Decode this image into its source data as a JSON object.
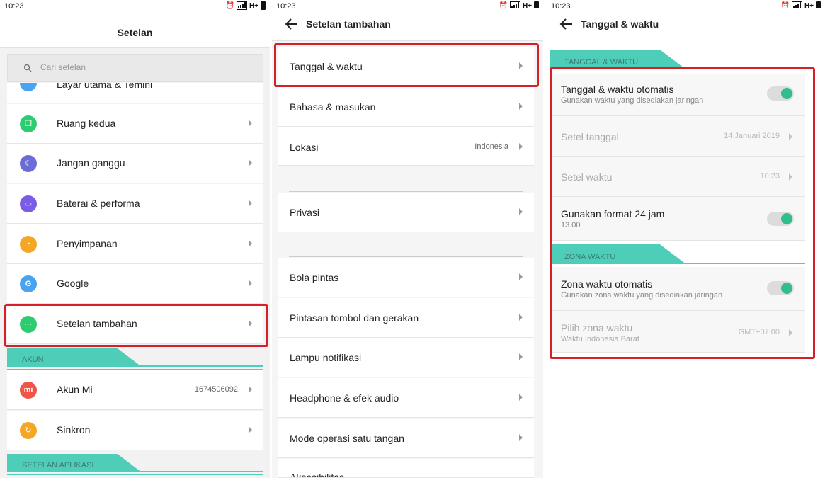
{
  "status_bar": {
    "time": "10:23",
    "network": "H+"
  },
  "screen1": {
    "title": "Setelan",
    "search_placeholder": "Cari setelan",
    "partial_item": "Layar utama & Temini",
    "items": [
      {
        "label": "Ruang kedua",
        "icon": "copy-icon",
        "color": "#2ecc71"
      },
      {
        "label": "Jangan ganggu",
        "icon": "moon-icon",
        "color": "#6c6cd8"
      },
      {
        "label": "Baterai & performa",
        "icon": "battery-icon",
        "color": "#7b5ce6"
      },
      {
        "label": "Penyimpanan",
        "icon": "storage-icon",
        "color": "#f5a623"
      },
      {
        "label": "Google",
        "icon": "google-icon",
        "color": "#4aa3f0"
      },
      {
        "label": "Setelan tambahan",
        "icon": "more-icon",
        "color": "#2ecc71"
      }
    ],
    "section_akun": "AKUN",
    "akun_items": [
      {
        "label": "Akun Mi",
        "value": "1674506092",
        "icon": "mi-icon",
        "color": "#f05545"
      },
      {
        "label": "Sinkron",
        "icon": "sync-icon",
        "color": "#f5a623"
      }
    ],
    "section_apps": "SETELAN APLIKASI"
  },
  "screen2": {
    "title": "Setelan tambahan",
    "group1": [
      {
        "label": "Tanggal & waktu"
      },
      {
        "label": "Bahasa & masukan"
      },
      {
        "label": "Lokasi",
        "value": "Indonesia"
      }
    ],
    "group2": [
      {
        "label": "Privasi"
      }
    ],
    "group3": [
      {
        "label": "Bola pintas"
      },
      {
        "label": "Pintasan tombol dan gerakan"
      },
      {
        "label": "Lampu notifikasi"
      },
      {
        "label": "Headphone & efek audio"
      },
      {
        "label": "Mode operasi satu tangan"
      },
      {
        "label": "Aksesibilitas"
      }
    ]
  },
  "screen3": {
    "title": "Tanggal & waktu",
    "section1": "TANGGAL & WAKTU",
    "auto_datetime": {
      "label": "Tanggal & waktu otomatis",
      "sub": "Gunakan waktu yang disediakan jaringan",
      "on": true
    },
    "set_date": {
      "label": "Setel tanggal",
      "value": "14 Januari 2019"
    },
    "set_time": {
      "label": "Setel waktu",
      "value": "10:23"
    },
    "format24": {
      "label": "Gunakan format 24 jam",
      "sub": "13.00",
      "on": true
    },
    "section2": "ZONA WAKTU",
    "auto_zone": {
      "label": "Zona waktu otomatis",
      "sub": "Gunakan zona waktu yang disediakan jaringan",
      "on": true
    },
    "pick_zone": {
      "label": "Pilih zona waktu",
      "sub": "Waktu Indonesia Barat",
      "value": "GMT+07:00"
    }
  },
  "colors": {
    "accent": "#4ecdb9",
    "toggle_on": "#2fbf8b",
    "highlight": "#d61f26"
  }
}
